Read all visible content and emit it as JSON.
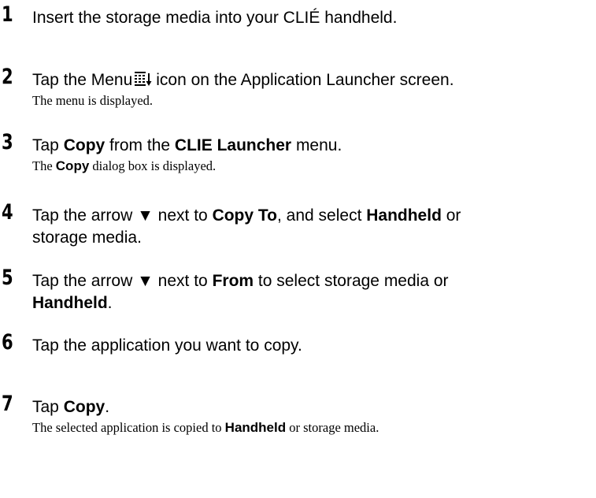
{
  "steps": [
    {
      "number": "1",
      "text": "Insert the storage media into your CLIÉ handheld."
    },
    {
      "number": "2",
      "text_before_icon": "Tap the Menu",
      "icon": "menu-icon",
      "text_after_icon": "icon on the Application Launcher screen.",
      "note": "The menu is displayed."
    },
    {
      "number": "3",
      "t1": "Tap ",
      "b1": "Copy",
      "t2": " from the ",
      "b2": "CLIE Launcher",
      "t3": " menu.",
      "note_t1": "The ",
      "note_b1": "Copy",
      "note_t2": " dialog box is displayed."
    },
    {
      "number": "4",
      "t1": "Tap the arrow ▼ next to ",
      "b1": "Copy To",
      "t2": ", and select ",
      "b2": "Handheld",
      "t3": " or",
      "line2": "storage media."
    },
    {
      "number": "5",
      "t1": "Tap the arrow ▼ next to ",
      "b1": "From",
      "t2": " to select storage media or",
      "b2": "Handheld",
      "t3": "."
    },
    {
      "number": "6",
      "text": "Tap the application you want to copy."
    },
    {
      "number": "7",
      "t1": "Tap ",
      "b1": "Copy",
      "t2": ".",
      "note_t1": "The selected application is copied to ",
      "note_b1": "Handheld",
      "note_t2": " or storage media."
    }
  ]
}
